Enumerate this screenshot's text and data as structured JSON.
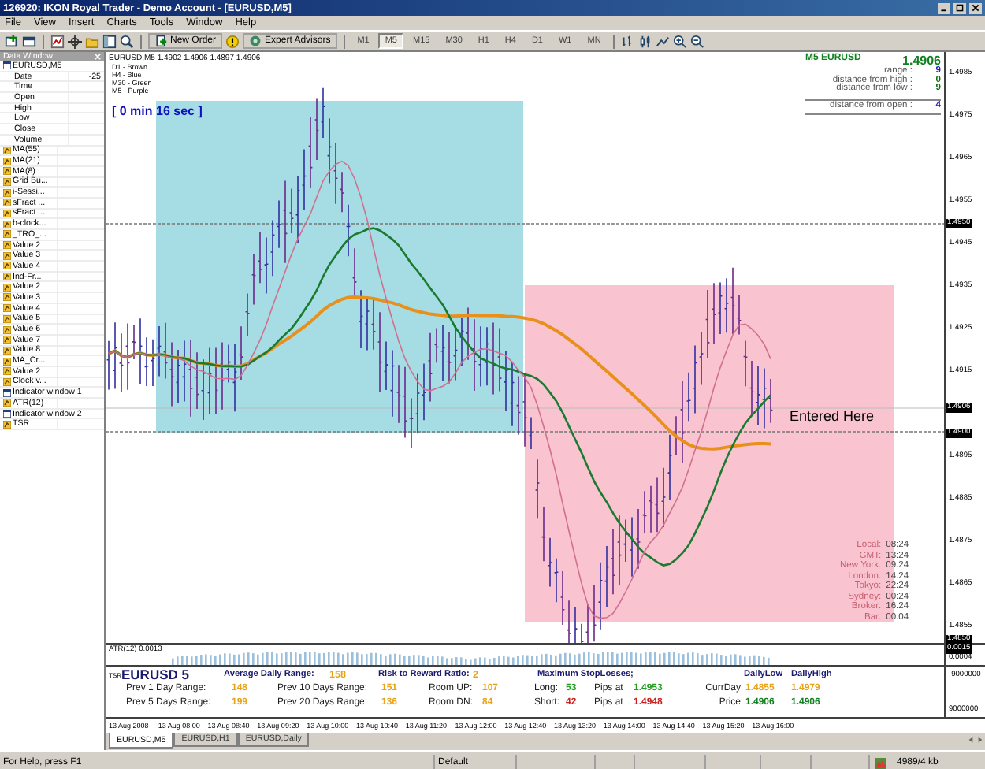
{
  "window": {
    "title": "126920: IKON Royal Trader - Demo Account - [EURUSD,M5]"
  },
  "menu": [
    "File",
    "View",
    "Insert",
    "Charts",
    "Tools",
    "Window",
    "Help"
  ],
  "toolbar": {
    "buttons": [
      {
        "label": "New Order"
      },
      {
        "label": "Expert Advisors"
      }
    ],
    "timeframes": [
      {
        "label": "M1",
        "selected": false
      },
      {
        "label": "M5",
        "selected": true
      },
      {
        "label": "M15",
        "selected": false
      },
      {
        "label": "M30",
        "selected": false
      },
      {
        "label": "H1",
        "selected": false
      },
      {
        "label": "H4",
        "selected": false
      },
      {
        "label": "D1",
        "selected": false
      },
      {
        "label": "W1",
        "selected": false
      },
      {
        "label": "MN",
        "selected": false
      }
    ]
  },
  "data_window": {
    "title": "Data Window",
    "rows": [
      {
        "kind": "symbol",
        "label": "EURUSD,M5"
      },
      {
        "kind": "field",
        "label": "Date",
        "value": "-25"
      },
      {
        "kind": "field",
        "label": "Time"
      },
      {
        "kind": "field",
        "label": "Open"
      },
      {
        "kind": "field",
        "label": "High"
      },
      {
        "kind": "field",
        "label": "Low"
      },
      {
        "kind": "field",
        "label": "Close"
      },
      {
        "kind": "field",
        "label": "Volume"
      },
      {
        "kind": "indicator",
        "label": "MA(55)"
      },
      {
        "kind": "indicator",
        "label": "MA(21)"
      },
      {
        "kind": "indicator",
        "label": "MA(8)"
      },
      {
        "kind": "indicator",
        "label": "Grid Bu..."
      },
      {
        "kind": "indicator",
        "label": "i-Sessi..."
      },
      {
        "kind": "indicator",
        "label": "sFract ..."
      },
      {
        "kind": "indicator",
        "label": "sFract ..."
      },
      {
        "kind": "indicator",
        "label": "b-clock..."
      },
      {
        "kind": "indicator",
        "label": "_TRO_..."
      },
      {
        "kind": "indicator",
        "label": "Value 2"
      },
      {
        "kind": "indicator",
        "label": "Value 3"
      },
      {
        "kind": "indicator",
        "label": "Value 4"
      },
      {
        "kind": "indicator",
        "label": "Ind-Fr..."
      },
      {
        "kind": "indicator",
        "label": "Value 2"
      },
      {
        "kind": "indicator",
        "label": "Value 3"
      },
      {
        "kind": "indicator",
        "label": "Value 4"
      },
      {
        "kind": "indicator",
        "label": "Value 5"
      },
      {
        "kind": "indicator",
        "label": "Value 6"
      },
      {
        "kind": "indicator",
        "label": "Value 7"
      },
      {
        "kind": "indicator",
        "label": "Value 8"
      },
      {
        "kind": "indicator",
        "label": "MA_Cr..."
      },
      {
        "kind": "indicator",
        "label": "Value 2"
      },
      {
        "kind": "indicator",
        "label": "Clock v..."
      },
      {
        "kind": "window",
        "label": "Indicator window 1"
      },
      {
        "kind": "indicator",
        "label": "ATR(12)"
      },
      {
        "kind": "window",
        "label": "Indicator window 2"
      },
      {
        "kind": "indicator",
        "label": "TSR"
      }
    ]
  },
  "chart": {
    "header": "EURUSD,M5 1.4902 1.4906 1.4897 1.4906",
    "legend": [
      "D1 - Brown",
      "H4 - Blue",
      "M30 - Green",
      "M5 - Purple"
    ],
    "timer": "[ 0 min 16 sec ]",
    "info": {
      "title": "M5 EURUSD",
      "price": "1.4906",
      "rows": [
        {
          "label": "range :",
          "value": "9",
          "color": "#2020c0"
        },
        {
          "label": "distance from high :",
          "value": "0",
          "color": "#107010"
        },
        {
          "label": "distance from low :",
          "value": "9",
          "color": "#107010"
        },
        {
          "label": "distance from open :",
          "value": "4",
          "color": "#2020c0"
        }
      ]
    },
    "note": "Entered Here",
    "clocks": [
      {
        "label": "Local:",
        "time": "08:24"
      },
      {
        "label": "GMT:",
        "time": "13:24"
      },
      {
        "label": "New York:",
        "time": "09:24"
      },
      {
        "label": "London:",
        "time": "14:24"
      },
      {
        "label": "Tokyo:",
        "time": "22:24"
      },
      {
        "label": "Sydney:",
        "time": "00:24"
      },
      {
        "label": "Broker:",
        "time": "16:24"
      },
      {
        "label": "Bar:",
        "time": "00:04"
      }
    ],
    "price_axis": [
      {
        "label": "1.4985",
        "highlighted": false
      },
      {
        "label": "1.4975",
        "highlighted": false
      },
      {
        "label": "1.4965",
        "highlighted": false
      },
      {
        "label": "1.4955",
        "highlighted": false
      },
      {
        "label": "1.4950",
        "highlighted": true
      },
      {
        "label": "1.4945",
        "highlighted": false
      },
      {
        "label": "1.4935",
        "highlighted": false
      },
      {
        "label": "1.4925",
        "highlighted": false
      },
      {
        "label": "1.4915",
        "highlighted": false
      },
      {
        "label": "1.4906",
        "highlighted": true
      },
      {
        "label": "1.4900",
        "highlighted": true
      },
      {
        "label": "1.4895",
        "highlighted": false
      },
      {
        "label": "1.4885",
        "highlighted": false
      },
      {
        "label": "1.4875",
        "highlighted": false
      },
      {
        "label": "1.4865",
        "highlighted": false
      },
      {
        "label": "1.4855",
        "highlighted": false
      },
      {
        "label": "1.4850",
        "highlighted": true
      }
    ]
  },
  "atr_window": {
    "label": "ATR(12) 0.0013",
    "axis": [
      {
        "label": "0.0015",
        "highlighted": true
      },
      {
        "label": "0.0004",
        "highlighted": false
      }
    ]
  },
  "tsr_window": {
    "tag": "TSR",
    "axis": [
      "-9000000",
      "9000000"
    ],
    "header": [
      {
        "kind": "title",
        "text": "EURUSD 5"
      },
      {
        "kind": "heading",
        "text": "Average Daily Range:",
        "value": "158"
      },
      {
        "kind": "heading",
        "text": "Risk to Reward Ratio:",
        "value": "2"
      },
      {
        "kind": "heading",
        "text": "Maximum StopLosses;"
      },
      {
        "kind": "heading",
        "text": "DailyLow"
      },
      {
        "kind": "heading",
        "text": "DailyHigh"
      }
    ],
    "rows": [
      [
        {
          "kind": "label",
          "text": "Prev 1 Day Range:"
        },
        {
          "kind": "value",
          "text": "148",
          "color": "#e8a317"
        },
        {
          "kind": "label",
          "text": "Prev 10 Days Range:"
        },
        {
          "kind": "value",
          "text": "151",
          "color": "#e8a317"
        },
        {
          "kind": "label",
          "text": "Room UP:"
        },
        {
          "kind": "value",
          "text": "107",
          "color": "#e8a317"
        },
        {
          "kind": "label",
          "text": "Long:"
        },
        {
          "kind": "value",
          "text": "53",
          "color": "#22a022"
        },
        {
          "kind": "label",
          "text": "Pips at"
        },
        {
          "kind": "value",
          "text": "1.4953",
          "color": "#22a022"
        },
        {
          "kind": "label",
          "text": "CurrDay"
        },
        {
          "kind": "value",
          "text": "1.4855",
          "color": "#e8a317"
        },
        {
          "kind": "value",
          "text": "1.4979",
          "color": "#e8a317"
        }
      ],
      [
        {
          "kind": "label",
          "text": "Prev 5 Days Range:"
        },
        {
          "kind": "value",
          "text": "199",
          "color": "#e8a317"
        },
        {
          "kind": "label",
          "text": "Prev 20 Days Range:"
        },
        {
          "kind": "value",
          "text": "136",
          "color": "#e8a317"
        },
        {
          "kind": "label",
          "text": "Room DN:"
        },
        {
          "kind": "value",
          "text": "84",
          "color": "#e8a317"
        },
        {
          "kind": "label",
          "text": "Short:"
        },
        {
          "kind": "value",
          "text": "42",
          "color": "#cc2020"
        },
        {
          "kind": "label",
          "text": "Pips at"
        },
        {
          "kind": "value",
          "text": "1.4948",
          "color": "#cc2020"
        },
        {
          "kind": "label",
          "text": "Price"
        },
        {
          "kind": "value",
          "text": "1.4906",
          "color": "#108020"
        },
        {
          "kind": "value",
          "text": "1.4906",
          "color": "#108020"
        }
      ]
    ]
  },
  "time_axis": [
    "13 Aug 2008",
    "13 Aug 08:00",
    "13 Aug 08:40",
    "13 Aug 09:20",
    "13 Aug 10:00",
    "13 Aug 10:40",
    "13 Aug 11:20",
    "13 Aug 12:00",
    "13 Aug 12:40",
    "13 Aug 13:20",
    "13 Aug 14:00",
    "13 Aug 14:40",
    "13 Aug 15:20",
    "13 Aug 16:00"
  ],
  "tabs": [
    {
      "label": "EURUSD,M5",
      "selected": true
    },
    {
      "label": "EURUSD,H1",
      "selected": false
    },
    {
      "label": "EURUSD,Daily",
      "selected": false
    }
  ],
  "status_bar": {
    "help": "For Help, press F1",
    "profile": "Default",
    "traffic": "4989/4 kb"
  }
}
